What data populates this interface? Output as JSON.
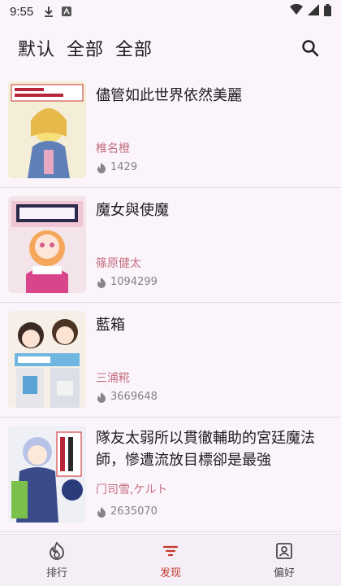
{
  "status": {
    "time": "9:55"
  },
  "header": {
    "title_parts": [
      "默认",
      "全部",
      "全部"
    ]
  },
  "colors": {
    "accent": "#c0392b",
    "author": "#c46f80",
    "background": "#fbf5fb"
  },
  "items": [
    {
      "title": "儘管如此世界依然美麗",
      "author": "椎名橙",
      "views": "1429",
      "cover_icon": "manga-cover-1"
    },
    {
      "title": "魔女與使魔",
      "author": "篠原健太",
      "views": "1094299",
      "cover_icon": "manga-cover-2"
    },
    {
      "title": "藍箱",
      "author": "三浦糀",
      "views": "3669648",
      "cover_icon": "manga-cover-3"
    },
    {
      "title": "隊友太弱所以貫徹輔助的宮廷魔法師，慘遭流放目標卻是最強",
      "author": "门司雪,ケルト",
      "views": "2635070",
      "cover_icon": "manga-cover-4"
    }
  ],
  "nav": [
    {
      "label": "排行",
      "icon": "flame-icon"
    },
    {
      "label": "发现",
      "icon": "filter-icon"
    },
    {
      "label": "偏好",
      "icon": "profile-icon"
    }
  ]
}
